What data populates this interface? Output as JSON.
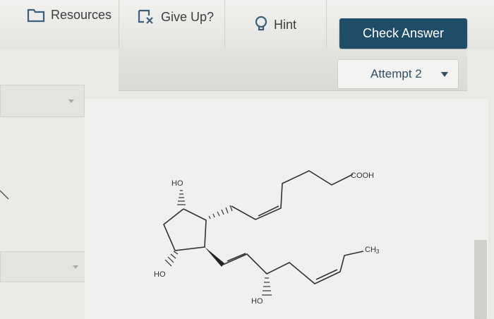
{
  "toolbar": {
    "resources_label": "Resources",
    "giveup_label": "Give Up?",
    "hint_label": "Hint",
    "check_answer_label": "Check Answer"
  },
  "attempt": {
    "selected": "Attempt 2"
  },
  "molecule": {
    "cooh": "COOH",
    "ch3": "CH",
    "ch3_sub": "3",
    "ho_top": "HO",
    "ho_left": "HO",
    "ho_bottom": "HO"
  },
  "colors": {
    "accent": "#1f4d68"
  }
}
